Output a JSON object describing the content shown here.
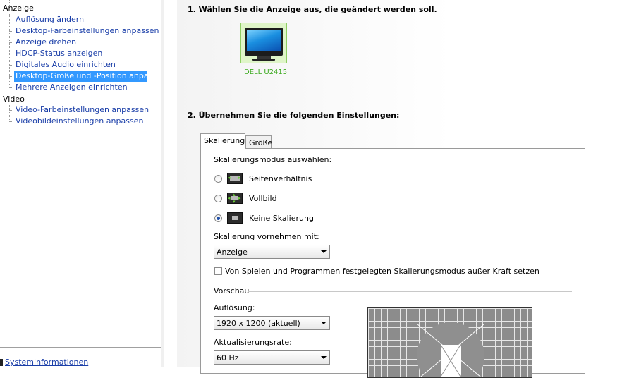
{
  "tree": {
    "categories": {
      "anzeige": "Anzeige",
      "video": "Video"
    },
    "anzeige_items": [
      "Auflösung ändern",
      "Desktop-Farbeinstellungen anpassen",
      "Anzeige drehen",
      "HDCP-Status anzeigen",
      "Digitales Audio einrichten",
      "Desktop-Größe und -Position anpassen",
      "Mehrere Anzeigen einrichten"
    ],
    "video_items": [
      "Video-Farbeinstellungen anpassen",
      "Videobildeinstellungen anpassen"
    ],
    "selected": "Desktop-Größe und -Position anpassen"
  },
  "footer": {
    "system_info_link": "Systeminformationen"
  },
  "main": {
    "step1_title": "1. Wählen Sie die Anzeige aus, die geändert werden soll.",
    "monitor_label": "DELL U2415",
    "step2_title": "2. Übernehmen Sie die folgenden Einstellungen:",
    "tabs": [
      "Skalierung",
      "Größe"
    ],
    "active_tab": "Skalierung",
    "scaling_mode_label": "Skalierungsmodus auswählen:",
    "scaling_modes": [
      {
        "label": "Seitenverhältnis",
        "checked": false
      },
      {
        "label": "Vollbild",
        "checked": false
      },
      {
        "label": "Keine Skalierung",
        "checked": true
      }
    ],
    "scale_with_label": "Skalierung vornehmen mit:",
    "scale_with_value": "Anzeige",
    "override_checkbox_label": "Von Spielen und Programmen festgelegten Skalierungsmodus außer Kraft setzen",
    "override_checked": false,
    "preview_group_label": "Vorschau",
    "resolution_label": "Auflösung:",
    "resolution_value": "1920 x 1200 (aktuell)",
    "refresh_label": "Aktualisierungsrate:",
    "refresh_value": "60 Hz"
  },
  "colors": {
    "selection": "#3399ff",
    "link": "#1a3ea8",
    "monitor_label": "#3caa1f"
  },
  "icons": [
    "monitor-icon",
    "aspect-ratio-icon",
    "fullscreen-icon",
    "no-scaling-icon",
    "system-info-icon",
    "dropdown-caret-icon"
  ]
}
